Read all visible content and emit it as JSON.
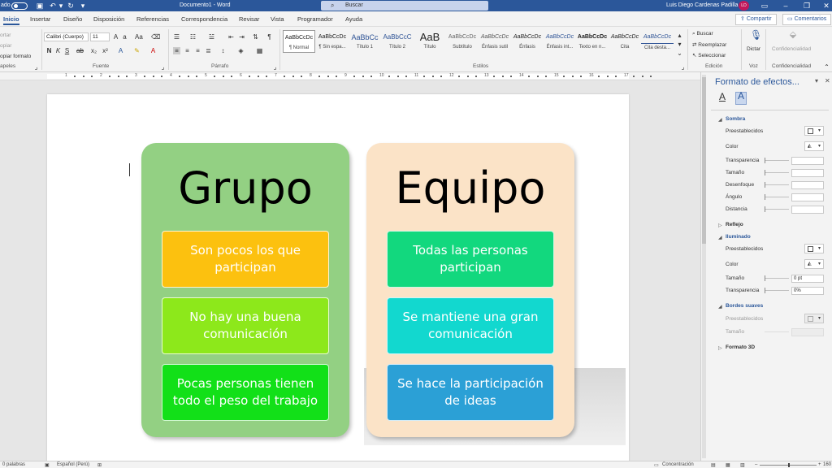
{
  "titlebar": {
    "autosave_label": "ado",
    "doc_title": "Documento1 - Word",
    "search_placeholder": "Buscar",
    "user_name": "Luis Diego Cardenas Padilla",
    "user_initials": "LD"
  },
  "menubar": {
    "tabs": [
      "Inicio",
      "Insertar",
      "Diseño",
      "Disposición",
      "Referencias",
      "Correspondencia",
      "Revisar",
      "Vista",
      "Programador",
      "Ayuda"
    ],
    "share_label": "Compartir",
    "comments_label": "Comentarios"
  },
  "ribbon": {
    "clipboard": {
      "cut": "ortar",
      "copy": "opiar",
      "format_painter": "opiar formato",
      "group": "apeles"
    },
    "font": {
      "name": "Calibri (Cuerpo)",
      "size": "11",
      "group": "Fuente"
    },
    "paragraph": {
      "group": "Párrafo"
    },
    "styles": {
      "group": "Estilos",
      "items": [
        {
          "preview": "AaBbCcDc",
          "name": "¶ Normal"
        },
        {
          "preview": "AaBbCcDc",
          "name": "¶ Sin espa..."
        },
        {
          "preview": "AaBbCc",
          "name": "Título 1"
        },
        {
          "preview": "AaBbCcC",
          "name": "Título 2"
        },
        {
          "preview": "AaB",
          "name": "Título"
        },
        {
          "preview": "AaBbCcDc",
          "name": "Subtítulo"
        },
        {
          "preview": "AaBbCcDc",
          "name": "Énfasis sutil"
        },
        {
          "preview": "AaBbCcDc",
          "name": "Énfasis"
        },
        {
          "preview": "AaBbCcDc",
          "name": "Énfasis int..."
        },
        {
          "preview": "AaBbCcDc",
          "name": "Texto en n..."
        },
        {
          "preview": "AaBbCcDc",
          "name": "Cita"
        },
        {
          "preview": "AaBbCcDc",
          "name": "Cita desta..."
        }
      ]
    },
    "editing": {
      "find": "Buscar",
      "replace": "Reemplazar",
      "select": "Seleccionar",
      "group": "Edición"
    },
    "voice": {
      "dictate": "Dictar",
      "group": "Voz"
    },
    "sensitivity": {
      "label": "Confidencialidad",
      "group": "Confidencialidad"
    }
  },
  "ruler": {
    "numbers": [
      "1",
      "2",
      "3",
      "4",
      "5",
      "6",
      "7",
      "8",
      "9",
      "10",
      "11",
      "12",
      "13",
      "14",
      "15",
      "16",
      "17"
    ]
  },
  "document": {
    "group": {
      "title": "Grupo",
      "items": [
        "Son pocos los que participan",
        "No hay una buena comunicación",
        "Pocas personas tienen todo el peso del trabajo"
      ]
    },
    "team": {
      "title": "Equipo",
      "items": [
        "Todas las personas participan",
        "Se mantiene una gran comunicación",
        "Se hace la participación de ideas"
      ]
    }
  },
  "colors": {
    "accent": "#2b579a",
    "group_card": "#93d083",
    "team_card": "#fbe3c7",
    "group_boxes": [
      "#fcc10f",
      "#8de81b",
      "#12e018"
    ],
    "team_boxes": [
      "#12d87e",
      "#12d8cf",
      "#2ba0d6"
    ]
  },
  "panel": {
    "title": "Formato de efectos...",
    "shadow": {
      "section": "Sombra",
      "presets": "Preestablecidos",
      "color": "Color",
      "transparency": "Transparencia",
      "size": "Tamaño",
      "blur": "Desenfoque",
      "angle": "Ángulo",
      "distance": "Distancia"
    },
    "reflection": "Reflejo",
    "glow": {
      "section": "Iluminado",
      "presets": "Preestablecidos",
      "color": "Color",
      "size": "Tamaño",
      "size_value": "0 pt",
      "transparency": "Transparencia",
      "transparency_value": "0%"
    },
    "soft_edges": {
      "section": "Bordes suaves",
      "presets": "Preestablecidos",
      "size": "Tamaño"
    },
    "format3d": "Formato 3D"
  },
  "status": {
    "words": "0 palabras",
    "language": "Español (Perú)",
    "focus": "Concentración",
    "zoom": "160"
  }
}
